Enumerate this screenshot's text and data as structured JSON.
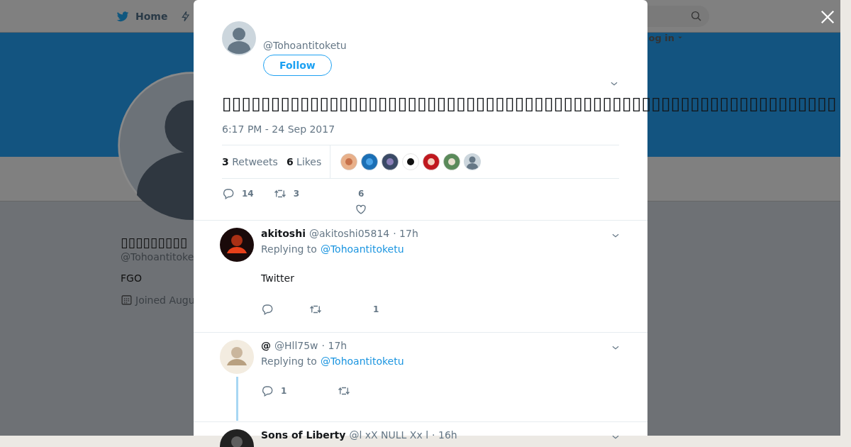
{
  "background_page": {
    "nav": {
      "home": "Home",
      "login": "og in"
    },
    "profile": {
      "name": "▯▯▯▯▯▯▯▯▯",
      "handle": "@Tohoantitoke",
      "bio": "FGO",
      "joined": "Joined Augu"
    }
  },
  "tweet": {
    "handle": "@Tohoantitoketu",
    "follow": "Follow",
    "text": "▯▯▯▯▯▯▯▯▯▯▯▯▯▯▯▯▯▯▯▯▯▯▯▯▯▯▯▯▯▯▯▯▯▯▯▯▯▯▯▯▯▯▯▯▯▯▯▯▯▯▯▯▯▯▯▯▯▯▯▯▯▯▯",
    "timestamp": "6:17 PM - 24 Sep 2017",
    "retweets": {
      "count": "3",
      "label": "Retweets"
    },
    "likes": {
      "count": "6",
      "label": "Likes"
    },
    "actions": {
      "replies": "14",
      "retweets": "3",
      "likes": "6"
    }
  },
  "replies": [
    {
      "name": "akitoshi",
      "handle": "@akitoshi05814",
      "time": "· 17h",
      "replying_label": "Replying to",
      "replying_to": "@Tohoantitoketu",
      "text": "Twitter",
      "like_count": "1"
    },
    {
      "name": "@",
      "handle": "@Hll75w",
      "time": "· 17h",
      "replying_label": "Replying to",
      "replying_to": "@Tohoantitoketu",
      "reply_count": "1",
      "thread": true
    },
    {
      "name": "Sons of Liberty",
      "handle": "@l xX NULL Xx l",
      "time": "· 16h"
    }
  ]
}
